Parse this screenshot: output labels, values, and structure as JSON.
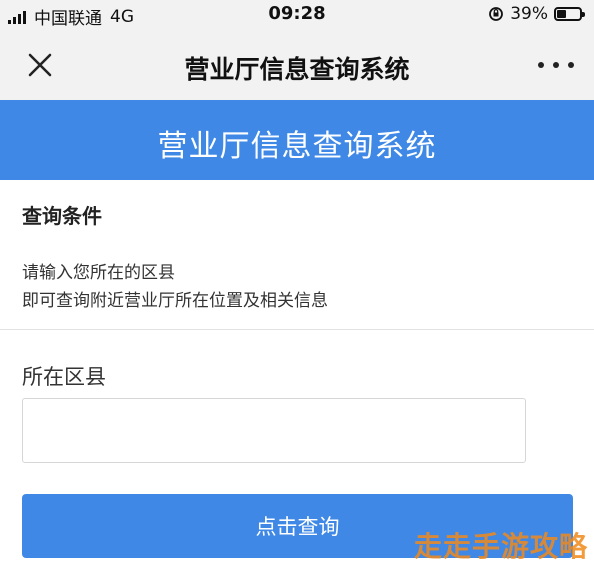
{
  "status_bar": {
    "carrier": "中国联通",
    "network": "4G",
    "time": "09:28",
    "battery": "39%",
    "battery_level": 0.39
  },
  "nav": {
    "title": "营业厅信息查询系统"
  },
  "header": {
    "title": "营业厅信息查询系统"
  },
  "conditions": {
    "title": "查询条件",
    "line1": "请输入您所在的区县",
    "line2": "即可查询附近营业厅所在位置及相关信息"
  },
  "form": {
    "district_label": "所在区县",
    "district_value": "",
    "query_button": "点击查询"
  },
  "watermark": {
    "text": "走走手游攻略"
  },
  "colors": {
    "accent": "#3f88e6",
    "watermark": "#f08a1c"
  }
}
